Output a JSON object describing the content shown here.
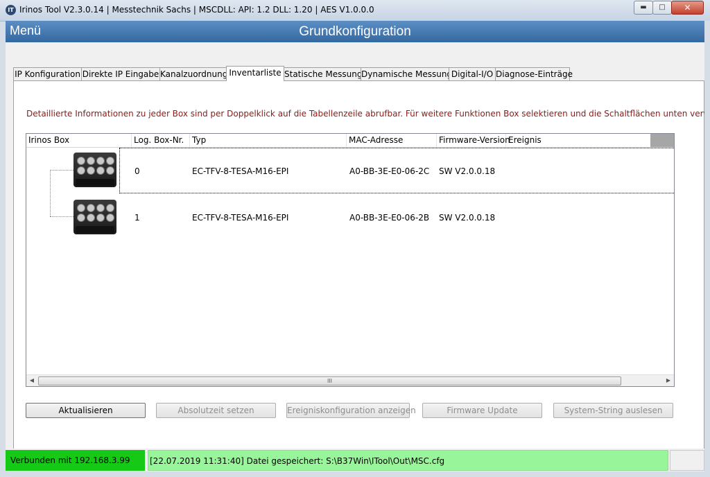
{
  "window": {
    "title": "Irinos Tool V2.3.0.14 | Messtechnik Sachs | MSCDLL: API: 1.2 DLL: 1.20 | AES V1.0.0.0",
    "app_icon_text": "IT",
    "min_glyph": "▬",
    "max_glyph": "□",
    "close_glyph": "✕"
  },
  "header": {
    "menu_label": "Menü",
    "page_title": "Grundkonfiguration"
  },
  "tabs": [
    {
      "label": "IP Konfiguration"
    },
    {
      "label": "Direkte IP Eingabe"
    },
    {
      "label": "Kanalzuordnung"
    },
    {
      "label": "Inventarliste"
    },
    {
      "label": "Statische Messung"
    },
    {
      "label": "Dynamische Messung"
    },
    {
      "label": "Digital-I/O"
    },
    {
      "label": "Diagnose-Einträge"
    }
  ],
  "active_tab": "Inventarliste",
  "info_text": "Detaillierte Informationen zu jeder Box sind per Doppelklick auf die Tabellenzeile abrufbar. Für weitere Funktionen Box selektieren und die Schaltflächen unten verwenden.",
  "grid": {
    "columns": [
      "Irinos Box",
      "Log. Box-Nr.",
      "Typ",
      "MAC-Adresse",
      "Firmware-Version",
      "Ereignis"
    ],
    "rows": [
      {
        "box_nr": "0",
        "typ": "EC-TFV-8-TESA-M16-EPI",
        "mac": "A0-BB-3E-E0-06-2C",
        "firmware": "SW V2.0.0.18",
        "ereignis": ""
      },
      {
        "box_nr": "1",
        "typ": "EC-TFV-8-TESA-M16-EPI",
        "mac": "A0-BB-3E-E0-06-2B",
        "firmware": "SW V2.0.0.18",
        "ereignis": ""
      }
    ],
    "scroll_left": "◀",
    "scroll_right": "▶",
    "scroll_grip": "III"
  },
  "buttons": {
    "refresh": "Aktualisieren",
    "set_time": "Absolutzeit setzen",
    "event_config": "Ereigniskonfiguration anzeigen",
    "firmware_update": "Firmware Update",
    "system_string": "System-String auslesen"
  },
  "status": {
    "connection": "Verbunden mit 192.168.3.99",
    "message": "[22.07.2019 11:31:40] Datei gespeichert: S:\\B37Win\\ITool\\Out\\MSC.cfg",
    "connection_color": "#16c916",
    "message_color": "#99f599"
  }
}
